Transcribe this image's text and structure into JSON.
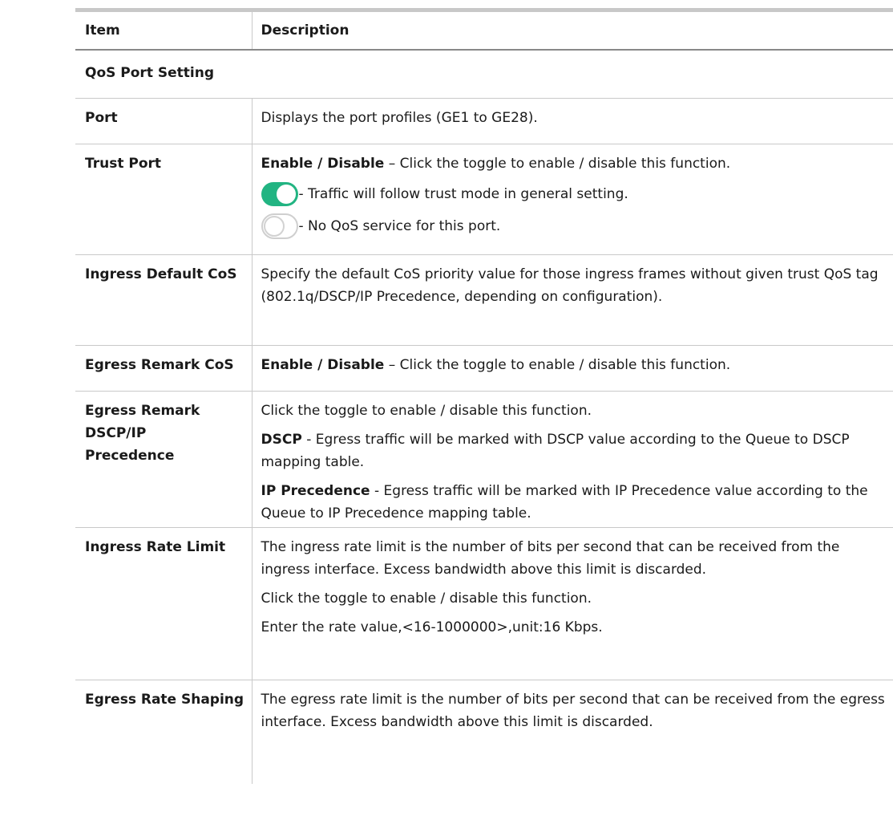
{
  "header": {
    "item": "Item",
    "description": "Description"
  },
  "section": "QoS Port Setting",
  "rows": {
    "port": {
      "item": "Port",
      "text": "Displays the port profiles (GE1 to GE28)."
    },
    "trust": {
      "item": "Trust Port",
      "bold": "Enable / Disable",
      "text": " – Click the toggle to enable / disable this function.",
      "on_text": "- Traffic will follow trust mode in general setting.",
      "off_text": "- No QoS service for this port."
    },
    "ingress_cos": {
      "item": "Ingress Default CoS",
      "text": "Specify the default CoS priority value for those ingress frames without given trust QoS tag (802.1q/DSCP/IP Precedence, depending on configuration)."
    },
    "egress_cos": {
      "item": "Egress Remark CoS",
      "bold": "Enable / Disable",
      "text": " – Click the toggle to enable / disable this function."
    },
    "egress_dscp": {
      "item": "Egress Remark DSCP/IP Precedence",
      "text": "Click the toggle to enable / disable this function.",
      "dscp_bold": "DSCP",
      "dscp_text": " - Egress traffic will be marked with DSCP value according to the Queue to DSCP mapping table.",
      "ipp_bold": "IP Precedence",
      "ipp_text": " - Egress traffic will be marked with IP Precedence value according to the Queue to IP Precedence mapping table."
    },
    "ingress_rate": {
      "item": "Ingress Rate Limit",
      "text1": "The ingress rate limit is the number of bits per second that can be received from the ingress interface. Excess bandwidth above this limit is discarded.",
      "text2": "Click the toggle to enable / disable this function.",
      "text3": "Enter the rate value,<16-1000000>,unit:16 Kbps."
    },
    "egress_rate": {
      "item": "Egress Rate Shaping",
      "text1": "The egress rate limit is the number of bits per second that can be received from the egress interface. Excess bandwidth above this limit is discarded."
    }
  },
  "toggles": {
    "on_color": "#22b482",
    "off_border": "#cfcfcf"
  }
}
